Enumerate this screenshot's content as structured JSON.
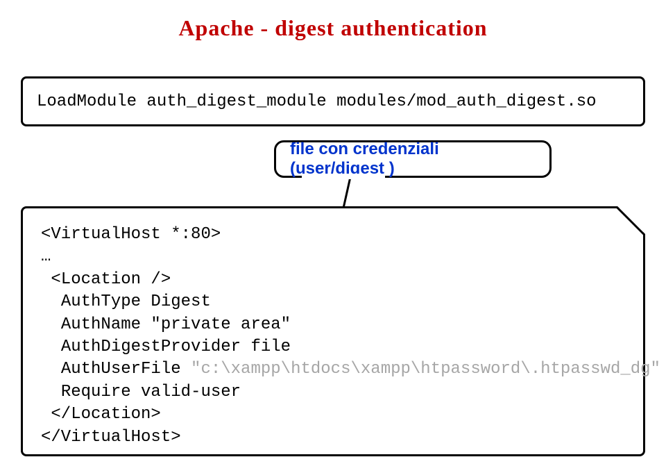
{
  "title": "Apache - digest authentication",
  "loadmodule": "LoadModule auth_digest_module modules/mod_auth_digest.so",
  "callout": "file con credenziali (user/digest )",
  "config": {
    "vhost_open": "<VirtualHost *:80>",
    "ellipsis": "…",
    "location_open": "<Location />",
    "authtype": "AuthType Digest",
    "authname": "AuthName \"private area\"",
    "provider": "AuthDigestProvider file",
    "authuserfile_label": "AuthUserFile ",
    "authuserfile_path": "\"c:\\xampp\\htdocs\\xampp\\htpassword\\.htpasswd_dg\"",
    "require": "Require valid-user",
    "location_close": "</Location>",
    "vhost_close": "</VirtualHost>"
  }
}
